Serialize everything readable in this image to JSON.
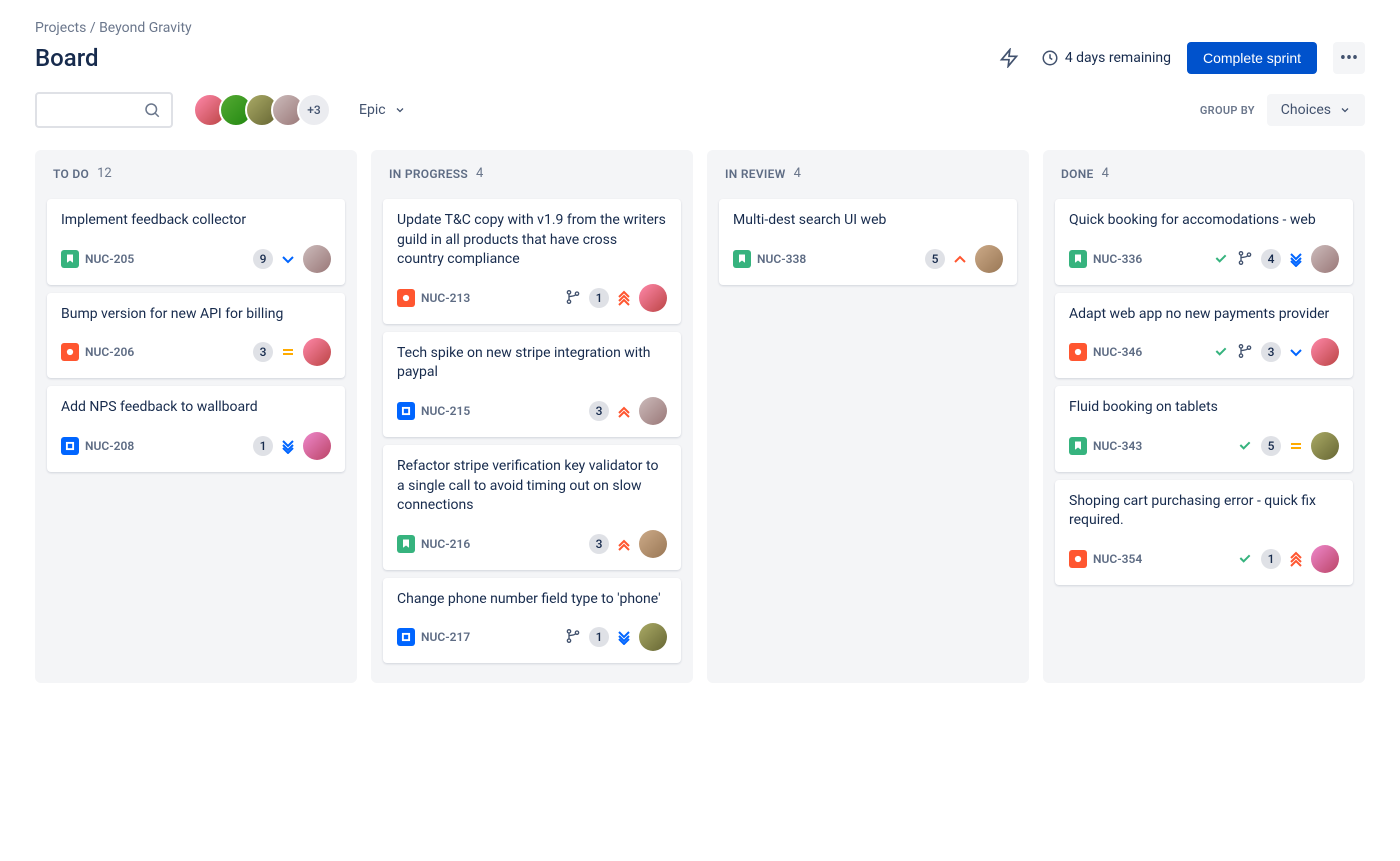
{
  "breadcrumbs": {
    "root": "Projects",
    "project": "Beyond Gravity"
  },
  "page_title": "Board",
  "header": {
    "remaining": "4 days remaining",
    "complete_label": "Complete sprint"
  },
  "toolbar": {
    "avatars_more": "+3",
    "epic_label": "Epic",
    "group_by_label": "GROUP BY",
    "choices_label": "Choices"
  },
  "columns": [
    {
      "title": "TO DO",
      "count": "12",
      "cards": [
        {
          "title": "Implement feedback collector",
          "type": "story",
          "key": "NUC-205",
          "estimate": "9",
          "priority": "low",
          "avatar": "av4",
          "check": false,
          "branch": false
        },
        {
          "title": "Bump version for new API for billing",
          "type": "bug",
          "key": "NUC-206",
          "estimate": "3",
          "priority": "medium",
          "avatar": "av1",
          "check": false,
          "branch": false
        },
        {
          "title": "Add NPS feedback to wallboard",
          "type": "task",
          "key": "NUC-208",
          "estimate": "1",
          "priority": "lowest",
          "avatar": "av6",
          "check": false,
          "branch": false
        }
      ]
    },
    {
      "title": "IN PROGRESS",
      "count": "4",
      "cards": [
        {
          "title": "Update T&C copy with v1.9 from the writers guild in all products that have cross country compliance",
          "type": "bug",
          "key": "NUC-213",
          "estimate": "1",
          "priority": "highest",
          "avatar": "av1",
          "check": false,
          "branch": true
        },
        {
          "title": "Tech spike on new stripe integration with paypal",
          "type": "task",
          "key": "NUC-215",
          "estimate": "3",
          "priority": "high",
          "avatar": "av4",
          "check": false,
          "branch": false
        },
        {
          "title": "Refactor stripe verification key validator to a single call to avoid timing out on slow connections",
          "type": "story",
          "key": "NUC-216",
          "estimate": "3",
          "priority": "high",
          "avatar": "av5",
          "check": false,
          "branch": false
        },
        {
          "title": "Change phone number field type to 'phone'",
          "type": "task",
          "key": "NUC-217",
          "estimate": "1",
          "priority": "lowest",
          "avatar": "av3",
          "check": false,
          "branch": true
        }
      ]
    },
    {
      "title": "IN REVIEW",
      "count": "4",
      "cards": [
        {
          "title": "Multi-dest search UI web",
          "type": "story",
          "key": "NUC-338",
          "estimate": "5",
          "priority": "medium-high",
          "avatar": "av5",
          "check": false,
          "branch": false
        }
      ]
    },
    {
      "title": "DONE",
      "count": "4",
      "cards": [
        {
          "title": "Quick booking for accomodations - web",
          "type": "story",
          "key": "NUC-336",
          "estimate": "4",
          "priority": "lowest",
          "avatar": "av4",
          "check": true,
          "branch": true
        },
        {
          "title": "Adapt web app no new payments provider",
          "type": "bug",
          "key": "NUC-346",
          "estimate": "3",
          "priority": "low",
          "avatar": "av1",
          "check": true,
          "branch": true
        },
        {
          "title": "Fluid booking on tablets",
          "type": "story",
          "key": "NUC-343",
          "estimate": "5",
          "priority": "medium",
          "avatar": "av3",
          "check": true,
          "branch": false
        },
        {
          "title": "Shoping cart purchasing error - quick fix required.",
          "type": "bug",
          "key": "NUC-354",
          "estimate": "1",
          "priority": "highest",
          "avatar": "av6",
          "check": true,
          "branch": false
        }
      ]
    }
  ]
}
